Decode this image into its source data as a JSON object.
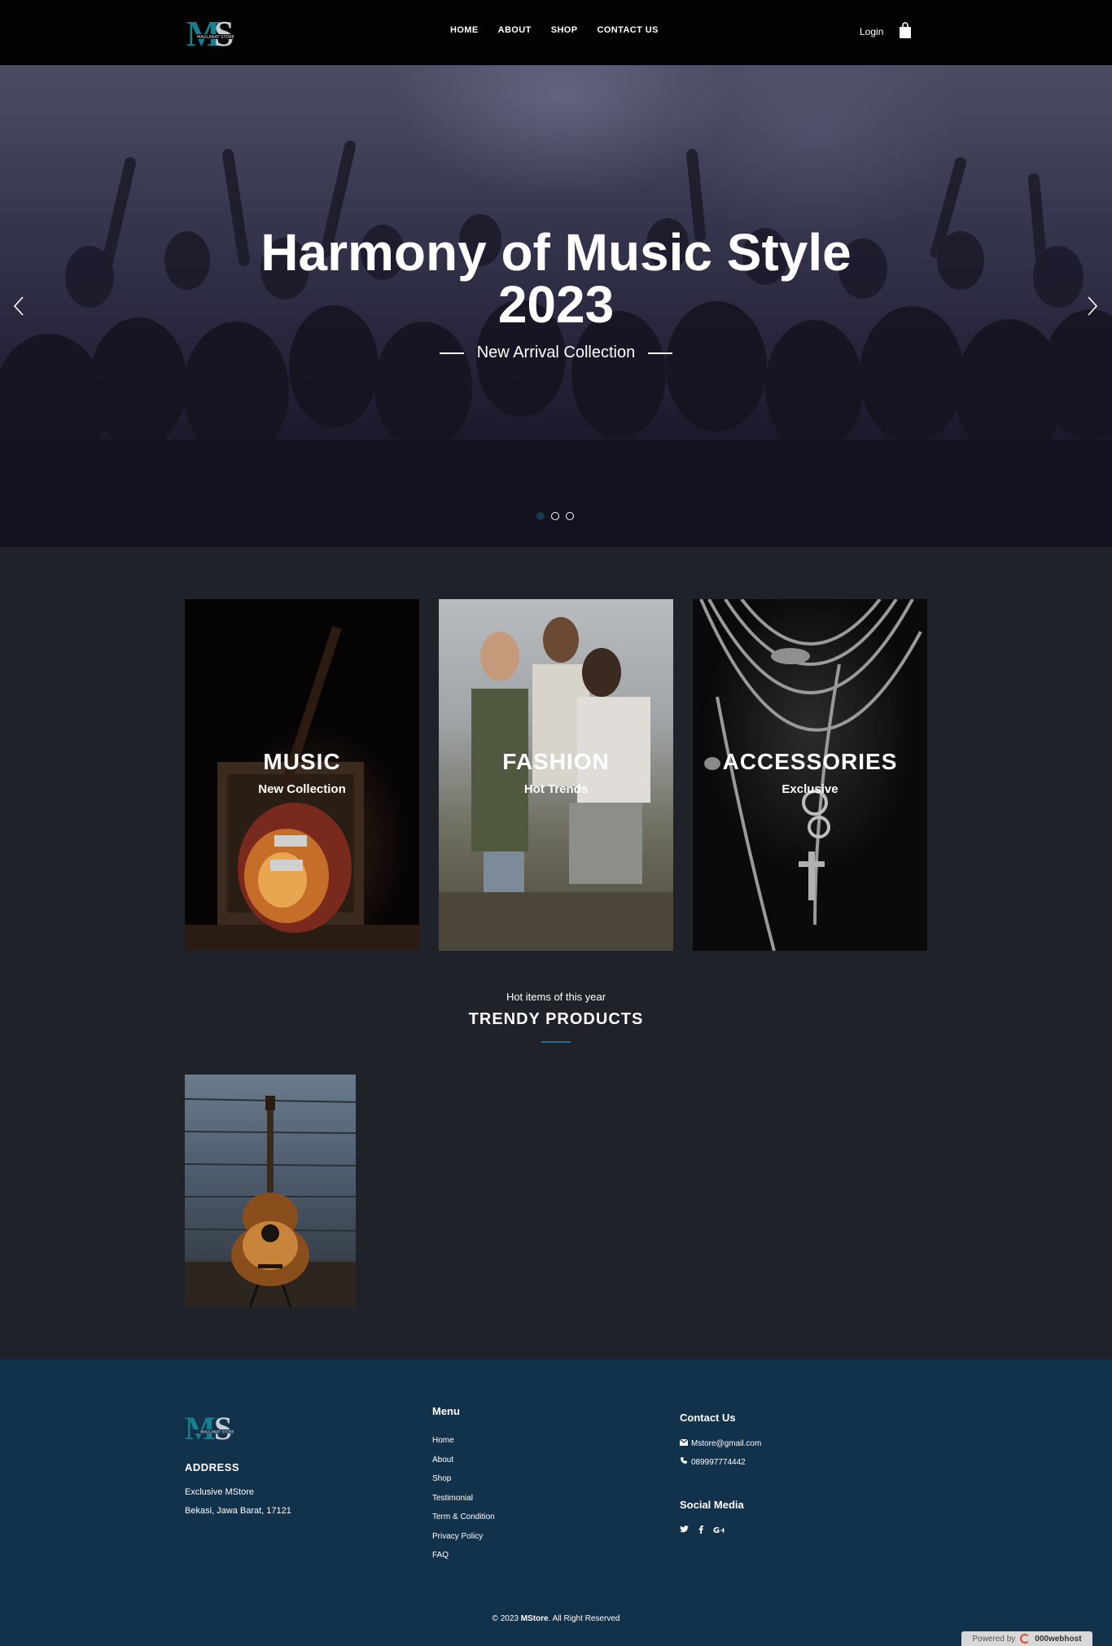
{
  "nav": {
    "logo_text": "MS",
    "logo_tagline": "MAULANAT STORE",
    "menu": [
      "HOME",
      "ABOUT",
      "SHOP",
      "CONTACT US"
    ],
    "login": "Login",
    "cart_icon": "shopping-bag-icon"
  },
  "hero": {
    "title_line1": "Harmony of Music Style",
    "title_line2": "2023",
    "subtitle": "New Arrival Collection",
    "slides_total": 3,
    "active_slide": 1
  },
  "categories": [
    {
      "title": "MUSIC",
      "subtitle": "New Collection"
    },
    {
      "title": "FASHION",
      "subtitle": "Hot Trends"
    },
    {
      "title": "ACCESSORIES",
      "subtitle": "Exclusive"
    }
  ],
  "trendy": {
    "kicker": "Hot items of this year",
    "title": "TRENDY PRODUCTS"
  },
  "footer": {
    "address_title": "ADDRESS",
    "address_line1": "Exclusive MStore",
    "address_line2": "Bekasi, Jawa Barat, 17121",
    "menu_title": "Menu",
    "menu": [
      "Home",
      "About",
      "Shop",
      "Testimonial",
      "Term & Condition",
      "Privacy Policy",
      "FAQ"
    ],
    "contact_title": "Contact Us",
    "email": "Mstore@gmail.com",
    "phone": "089997774442",
    "social_title": "Social Media",
    "social": [
      "twitter-icon",
      "facebook-icon",
      "google-plus-icon"
    ],
    "copyright_pre": "© 2023 ",
    "copyright_brand": "MStore",
    "copyright_post": ". All Right Reserved",
    "powered_label": "Powered by",
    "powered_brand": "000webhost"
  },
  "colors": {
    "accent": "#1f6e8c",
    "nav_bg": "#030304",
    "page_bg": "#1f2229",
    "footer_bg": "#12314a"
  }
}
